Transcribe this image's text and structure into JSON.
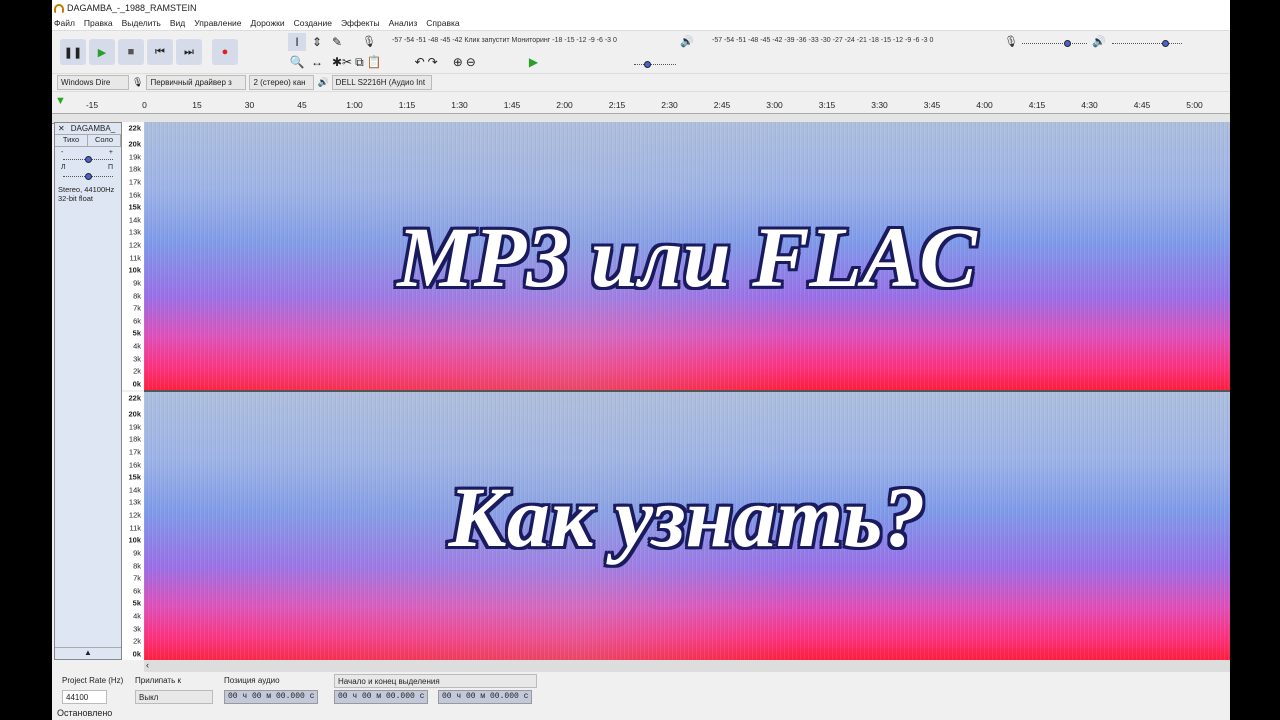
{
  "window": {
    "title": "DAGAMBA_-_1988_RAMSTEIN"
  },
  "menu": [
    "Файл",
    "Правка",
    "Выделить",
    "Вид",
    "Управление",
    "Дорожки",
    "Создание",
    "Эффекты",
    "Анализ",
    "Справка"
  ],
  "transport": {
    "pause": "❚❚",
    "play": "▶",
    "stop": "■",
    "skip_start": "⏮",
    "skip_end": "⏭",
    "record": "●"
  },
  "tools": [
    "I",
    "⇕",
    "✎",
    "🔍",
    "↔",
    "✱"
  ],
  "meters": {
    "record_scale": "-57 -54 -51 -48 -45 -42 Клик запустит Мониторинг -18 -15 -12 -9 -6 -3 0",
    "play_scale": "-57 -54 -51 -48 -45 -42 -39 -36 -33 -30 -27 -24 -21 -18 -15 -12 -9 -6 -3 0",
    "lr": "Л\nП"
  },
  "edit_icons": [
    "✂",
    "⧉",
    "📋",
    "↶",
    "↷",
    "⊕",
    "⊖"
  ],
  "devices": {
    "host": "Windows Dire",
    "input": "Первичный драйвер з",
    "channels": "2 (стерео) кан",
    "output": "DELL S2216H (Аудио Int"
  },
  "ruler": [
    "-15",
    "0",
    "15",
    "30",
    "45",
    "1:00",
    "1:15",
    "1:30",
    "1:45",
    "2:00",
    "2:15",
    "2:30",
    "2:45",
    "3:00",
    "3:15",
    "3:30",
    "3:45",
    "4:00",
    "4:15",
    "4:30",
    "4:45",
    "5:00"
  ],
  "track": {
    "name": "DAGAMBA_",
    "mute": "Тихо",
    "solo": "Соло",
    "gain_minus": "-",
    "gain_plus": "+",
    "pan_l": "Л",
    "pan_r": "П",
    "info1": "Stereo, 44100Hz",
    "info2": "32-bit float",
    "collapse": "▲"
  },
  "freq_labels": [
    "22k",
    "20k",
    "19k",
    "18k",
    "17k",
    "16k",
    "15k",
    "14k",
    "13k",
    "12k",
    "11k",
    "10k",
    "9k",
    "8k",
    "7k",
    "6k",
    "5k",
    "4k",
    "3k",
    "2k",
    "0k"
  ],
  "overlay": {
    "line1": "MP3 или FLAC",
    "line2": "Как узнать?"
  },
  "bottom": {
    "rate_label": "Project Rate (Hz)",
    "rate": "44100",
    "snap_label": "Прилипать к",
    "snap": "Выкл",
    "pos_label": "Позиция аудио",
    "pos": "00 ч 00 м 00.000 с",
    "sel_label": "Начало и конец выделения",
    "sel_start": "00 ч 00 м 00.000 с",
    "sel_end": "00 ч 00 м 00.000 с",
    "status": "Остановлено"
  },
  "colors": {
    "record": "#e02020",
    "play": "#2aa02a"
  }
}
